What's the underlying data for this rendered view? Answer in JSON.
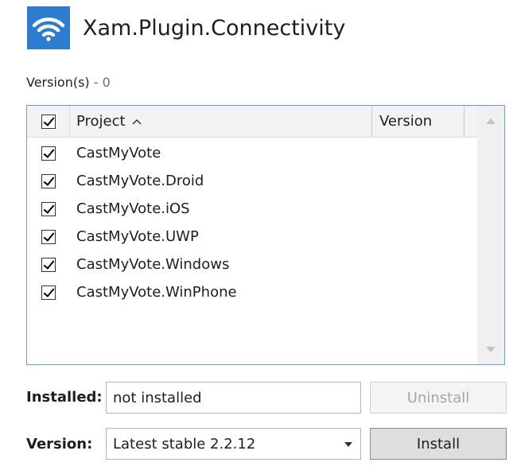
{
  "package": {
    "title": "Xam.Plugin.Connectivity",
    "icon": "wifi-icon",
    "icon_color": "#2d7cd0"
  },
  "versions": {
    "label": "Version(s)",
    "separator": "-",
    "count": "0"
  },
  "grid": {
    "columns": {
      "project": "Project",
      "version": "Version"
    },
    "sort_indicator": "^",
    "select_all_checked": true,
    "rows": [
      {
        "name": "CastMyVote",
        "checked": true
      },
      {
        "name": "CastMyVote.Droid",
        "checked": true
      },
      {
        "name": "CastMyVote.iOS",
        "checked": true
      },
      {
        "name": "CastMyVote.UWP",
        "checked": true
      },
      {
        "name": "CastMyVote.Windows",
        "checked": true
      },
      {
        "name": "CastMyVote.WinPhone",
        "checked": true
      }
    ]
  },
  "installed": {
    "label": "Installed:",
    "value": "not installed",
    "uninstall_label": "Uninstall"
  },
  "version_select": {
    "label": "Version:",
    "value": "Latest stable 2.2.12",
    "install_label": "Install"
  }
}
